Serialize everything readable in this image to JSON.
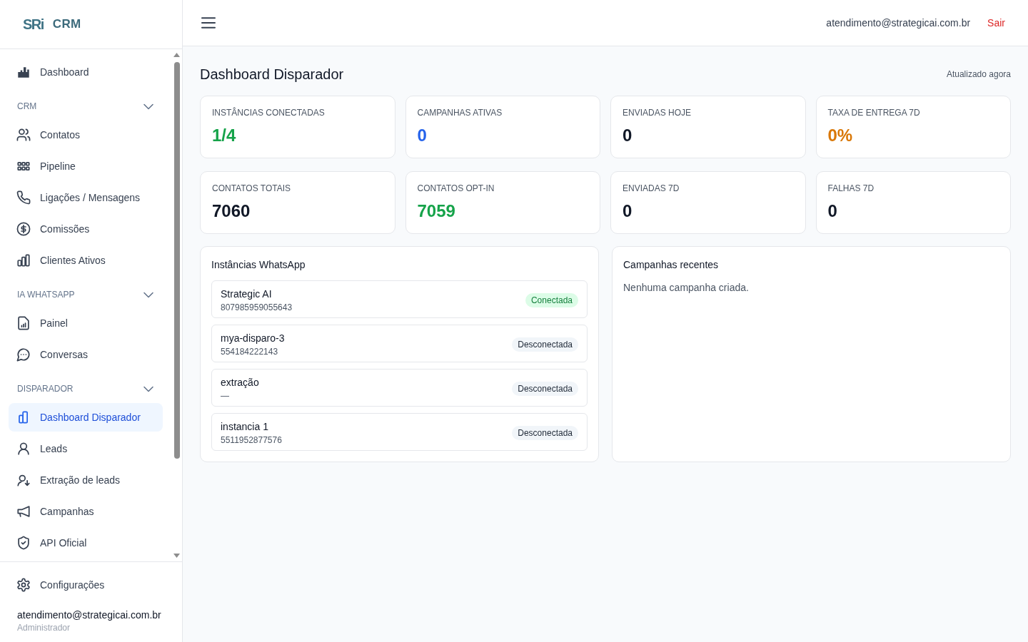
{
  "sidebar": {
    "logo": {
      "mark": "SRi",
      "name": "CRM"
    },
    "top_items": [
      {
        "label": "Dashboard",
        "selected": false
      }
    ],
    "sections": [
      {
        "title": "CRM",
        "expanded": true,
        "items": [
          {
            "label": "Contatos",
            "selected": false
          },
          {
            "label": "Pipeline",
            "selected": false
          },
          {
            "label": "Ligações / Mensagens",
            "selected": false
          },
          {
            "label": "Comissões",
            "selected": false
          },
          {
            "label": "Clientes Ativos",
            "selected": false
          }
        ]
      },
      {
        "title": "IA WHATSAPP",
        "expanded": true,
        "items": [
          {
            "label": "Painel",
            "selected": false
          },
          {
            "label": "Conversas",
            "selected": false
          }
        ]
      },
      {
        "title": "DISPARADOR",
        "expanded": true,
        "items": [
          {
            "label": "Dashboard Disparador",
            "selected": true
          },
          {
            "label": "Leads",
            "selected": false
          },
          {
            "label": "Extração de leads",
            "selected": false
          },
          {
            "label": "Campanhas",
            "selected": false
          },
          {
            "label": "API Oficial",
            "selected": false
          }
        ]
      }
    ],
    "footer_items": [
      {
        "label": "Configurações",
        "selected": false
      }
    ],
    "user": {
      "email": "atendimento@strategicai.com.br",
      "role": "Administrador"
    }
  },
  "header": {
    "user_email": "atendimento@strategicai.com.br",
    "logout": "Sair"
  },
  "main": {
    "title": "Dashboard Disparador",
    "updated": "Atualizado agora",
    "stats": [
      {
        "label": "INSTÂNCIAS CONECTADAS",
        "value": "1/4",
        "color": "#16a34a"
      },
      {
        "label": "CAMPANHAS ATIVAS",
        "value": "0",
        "color": "#2563eb"
      },
      {
        "label": "ENVIADAS HOJE",
        "value": "0",
        "color": "#111827"
      },
      {
        "label": "TAXA DE ENTREGA 7D",
        "value": "0%",
        "color": "#d97706"
      },
      {
        "label": "CONTATOS TOTAIS",
        "value": "7060",
        "color": "#111827"
      },
      {
        "label": "CONTATOS OPT-IN",
        "value": "7059",
        "color": "#16a34a"
      },
      {
        "label": "ENVIADAS 7D",
        "value": "0",
        "color": "#111827"
      },
      {
        "label": "FALHAS 7D",
        "value": "0",
        "color": "#111827"
      }
    ],
    "instances_panel": {
      "title": "Instâncias WhatsApp",
      "instances": [
        {
          "name": "Strategic AI",
          "number": "807985959055643",
          "status": "Conectada",
          "connected": true
        },
        {
          "name": "mya-disparo-3",
          "number": "554184222143",
          "status": "Desconectada",
          "connected": false
        },
        {
          "name": "extração",
          "number": "—",
          "status": "Desconectada",
          "connected": false
        },
        {
          "name": "instancia 1",
          "number": "5511952877576",
          "status": "Desconectada",
          "connected": false
        }
      ]
    },
    "campaigns_panel": {
      "title": "Campanhas recentes",
      "empty_text": "Nenhuma campanha criada."
    }
  }
}
